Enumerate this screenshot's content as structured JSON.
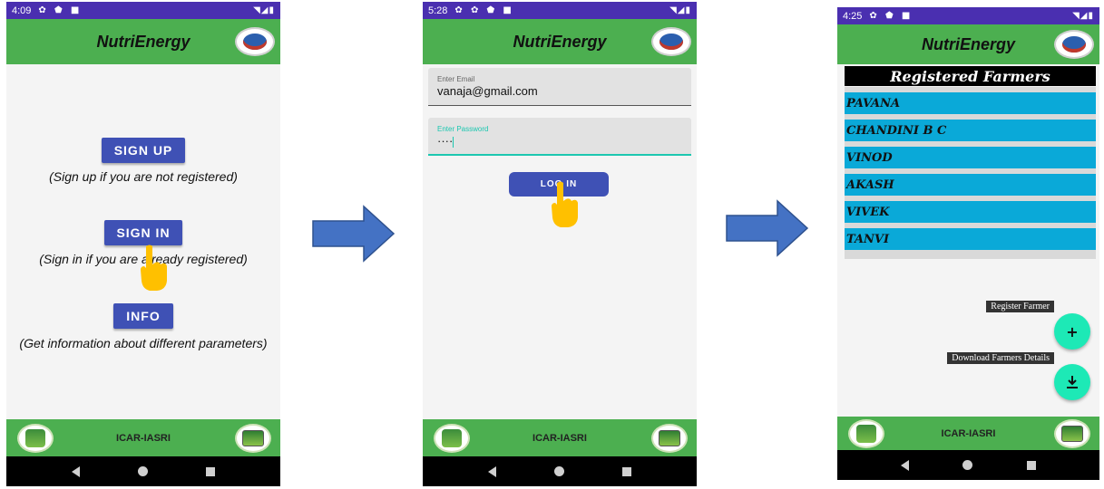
{
  "colors": {
    "status_bar": "#4a2fb0",
    "app_bar": "#4caf50",
    "button": "#3f51b5",
    "list_row": "#0aa9d8",
    "fab": "#1de9b6",
    "arrow": "#4472c4",
    "hand": "#ffc000"
  },
  "common": {
    "app_title": "NutriEnergy",
    "footer_text": "ICAR-IASRI"
  },
  "screen1": {
    "time": "4:09",
    "signup_label": "SIGN UP",
    "signup_caption": "(Sign up if you are not registered)",
    "signin_label": "SIGN IN",
    "signin_caption": "(Sign in if you are already registered)",
    "info_label": "INFO",
    "info_caption": "(Get information about different parameters)"
  },
  "screen2": {
    "time": "5:28",
    "email_label": "Enter Email",
    "email_value": "vanaja@gmail.com",
    "password_label": "Enter Password",
    "password_value": "····",
    "login_label": "LOG IN"
  },
  "screen3": {
    "time": "4:25",
    "list_title": "Registered Farmers",
    "farmers": [
      "PAVANA",
      "CHANDINI B C",
      "VINOD",
      "AKASH",
      "VIVEK",
      "TANVI"
    ],
    "register_label": "Register Farmer",
    "download_label": "Download Farmers Details",
    "register_icon": "plus-icon",
    "download_icon": "download-icon"
  }
}
